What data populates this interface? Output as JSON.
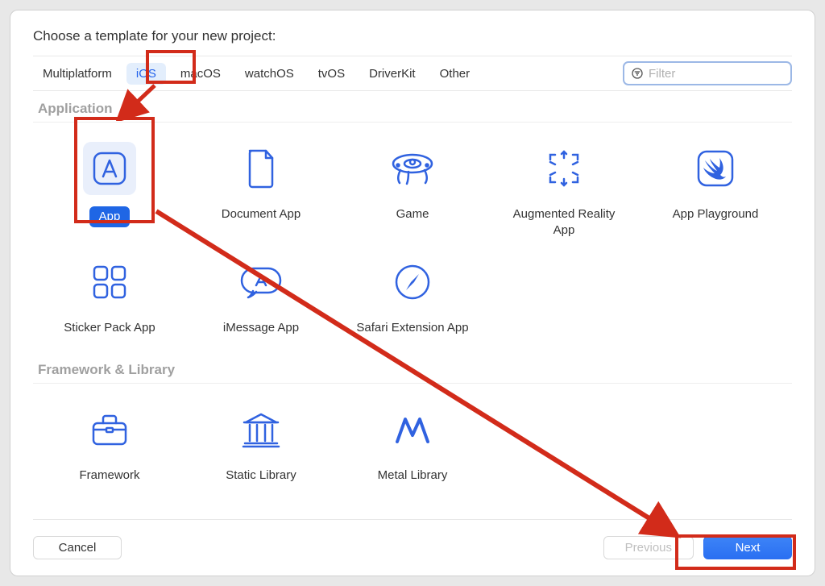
{
  "title": "Choose a template for your new project:",
  "platforms": [
    "Multiplatform",
    "iOS",
    "macOS",
    "watchOS",
    "tvOS",
    "DriverKit",
    "Other"
  ],
  "selected_platform_index": 1,
  "filter": {
    "placeholder": "Filter",
    "value": ""
  },
  "sections": [
    {
      "name": "Application",
      "templates": [
        {
          "label": "App",
          "icon": "app-icon",
          "selected": true
        },
        {
          "label": "Document App",
          "icon": "document-icon",
          "selected": false
        },
        {
          "label": "Game",
          "icon": "game-icon",
          "selected": false
        },
        {
          "label": "Augmented Reality App",
          "icon": "ar-icon",
          "selected": false
        },
        {
          "label": "App Playground",
          "icon": "swift-icon",
          "selected": false
        },
        {
          "label": "Sticker Pack App",
          "icon": "sticker-icon",
          "selected": false
        },
        {
          "label": "iMessage App",
          "icon": "imessage-icon",
          "selected": false
        },
        {
          "label": "Safari Extension App",
          "icon": "safari-icon",
          "selected": false
        }
      ]
    },
    {
      "name": "Framework & Library",
      "templates": [
        {
          "label": "Framework",
          "icon": "framework-icon",
          "selected": false
        },
        {
          "label": "Static Library",
          "icon": "library-icon",
          "selected": false
        },
        {
          "label": "Metal Library",
          "icon": "metal-icon",
          "selected": false
        }
      ]
    }
  ],
  "buttons": {
    "cancel": "Cancel",
    "previous": "Previous",
    "next": "Next"
  },
  "colors": {
    "accent": "#3062e0",
    "annotation": "#d22b1a"
  }
}
